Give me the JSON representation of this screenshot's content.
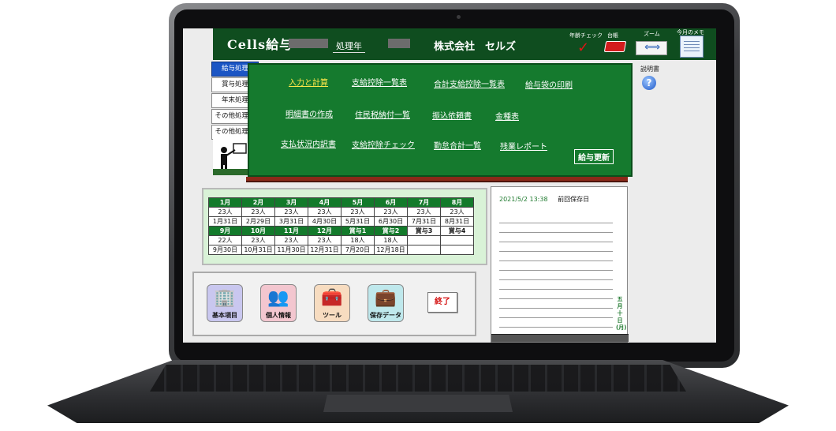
{
  "app": {
    "title": "Cells給与",
    "year_label": "処理年",
    "company": "株式会社　セルズ"
  },
  "toolbar": {
    "age_check_label": "年齢チェック",
    "ledger_label": "台帳",
    "zoom_label": "ズーム",
    "month_memo_label": "今月のメモ",
    "help_label": "説明書",
    "help_glyph": "?"
  },
  "tabs": [
    {
      "label": "給与処理",
      "active": true
    },
    {
      "label": "賞与処理",
      "active": false
    },
    {
      "label": "年末処理",
      "active": false
    },
    {
      "label": "その他処理 A",
      "active": false
    },
    {
      "label": "その他処理 B",
      "active": false
    }
  ],
  "board": {
    "links": [
      "入力と計算",
      "支給控除一覧表",
      "合計支給控除一覧表",
      "給与袋の印刷",
      "明細書の作成",
      "住民税納付一覧",
      "振込依頼書",
      "金種表",
      "支払状況内訳書",
      "支給控除チェック",
      "勤怠合計一覧",
      "残業レポート"
    ],
    "update_button": "給与更新"
  },
  "months": {
    "row1_headers": [
      "1月",
      "2月",
      "3月",
      "4月",
      "5月",
      "6月",
      "7月",
      "8月"
    ],
    "row1_counts": [
      "23人",
      "23人",
      "23人",
      "23人",
      "23人",
      "23人",
      "23人",
      "23人"
    ],
    "row1_dates": [
      "1月31日",
      "2月29日",
      "3月31日",
      "4月30日",
      "5月31日",
      "6月30日",
      "7月31日",
      "8月31日"
    ],
    "row2_headers": [
      "9月",
      "10月",
      "11月",
      "12月",
      "賞与1",
      "賞与2",
      "賞与3",
      "賞与4"
    ],
    "row2_counts": [
      "22人",
      "23人",
      "23人",
      "23人",
      "18人",
      "18人",
      "",
      ""
    ],
    "row2_dates": [
      "9月30日",
      "10月31日",
      "11月30日",
      "12月31日",
      "7月20日",
      "12月18日",
      "",
      ""
    ]
  },
  "buttons": {
    "basic": "基本項目",
    "personal": "個人情報",
    "tools": "ツール",
    "saved": "保存データ",
    "exit": "終了"
  },
  "memo": {
    "date": "2021/5/2 13:38",
    "saved_label": "前回保存日",
    "vertical_text": [
      "五",
      "月",
      "十",
      "日",
      "(月)"
    ]
  }
}
